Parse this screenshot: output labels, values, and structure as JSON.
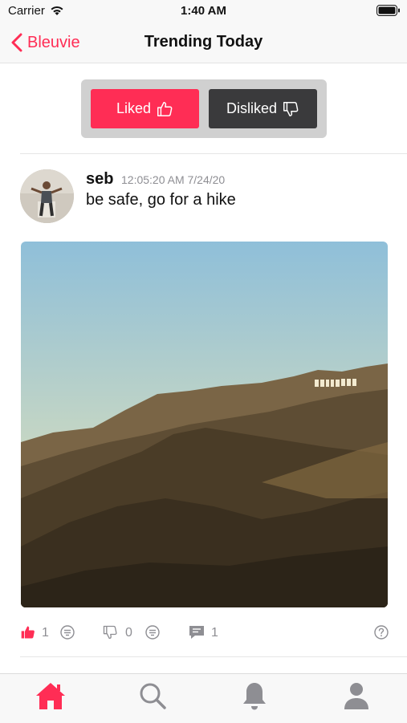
{
  "status_bar": {
    "carrier": "Carrier",
    "time": "1:40 AM"
  },
  "nav": {
    "back_label": "Bleuvie",
    "title": "Trending Today"
  },
  "segment": {
    "liked_label": "Liked",
    "disliked_label": "Disliked",
    "selected": "Liked"
  },
  "post": {
    "username": "seb",
    "timestamp": "12:05:20 AM 7/24/20",
    "text": "be safe, go for a hike",
    "image_icon": "hollywood-hills-photo",
    "likes": "1",
    "dislikes": "0",
    "comments": "1"
  },
  "tabs": [
    {
      "name": "home-icon",
      "selected": true
    },
    {
      "name": "search-icon",
      "selected": false
    },
    {
      "name": "bell-icon",
      "selected": false
    },
    {
      "name": "profile-icon",
      "selected": false
    }
  ],
  "colors": {
    "accent": "#ff2d55",
    "dark_segment": "#3a3a3c",
    "inactive_icon": "#8e8e93"
  }
}
